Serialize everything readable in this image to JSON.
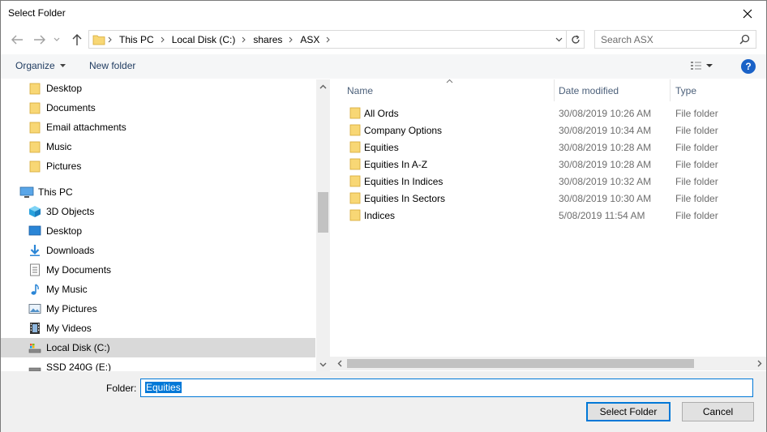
{
  "window": {
    "title": "Select Folder"
  },
  "address": {
    "crumbs": [
      "This PC",
      "Local Disk (C:)",
      "shares",
      "ASX"
    ]
  },
  "search": {
    "placeholder": "Search ASX"
  },
  "commands": {
    "organize": "Organize",
    "new_folder": "New folder"
  },
  "navigation": {
    "quick_access": [
      "Desktop",
      "Documents",
      "Email attachments",
      "Music",
      "Pictures"
    ],
    "this_pc_label": "This PC",
    "this_pc_items": [
      {
        "label": "3D Objects",
        "icon": "3d-objects-icon"
      },
      {
        "label": "Desktop",
        "icon": "desktop-icon"
      },
      {
        "label": "Downloads",
        "icon": "downloads-icon"
      },
      {
        "label": "My Documents",
        "icon": "documents-icon"
      },
      {
        "label": "My Music",
        "icon": "music-icon"
      },
      {
        "label": "My Pictures",
        "icon": "pictures-icon"
      },
      {
        "label": "My Videos",
        "icon": "videos-icon"
      },
      {
        "label": "Local Disk (C:)",
        "icon": "drive-icon",
        "selected": true
      },
      {
        "label": "SSD 240G (E:)",
        "icon": "drive-icon"
      }
    ]
  },
  "columns": {
    "name": "Name",
    "date": "Date modified",
    "type": "Type"
  },
  "files": [
    {
      "name": "All Ords",
      "date": "30/08/2019 10:26 AM",
      "type": "File folder"
    },
    {
      "name": "Company Options",
      "date": "30/08/2019 10:34 AM",
      "type": "File folder"
    },
    {
      "name": "Equities",
      "date": "30/08/2019 10:28 AM",
      "type": "File folder"
    },
    {
      "name": "Equities In A-Z",
      "date": "30/08/2019 10:28 AM",
      "type": "File folder"
    },
    {
      "name": "Equities In Indices",
      "date": "30/08/2019 10:32 AM",
      "type": "File folder"
    },
    {
      "name": "Equities In Sectors",
      "date": "30/08/2019 10:30 AM",
      "type": "File folder"
    },
    {
      "name": "Indices",
      "date": "5/08/2019 11:54 AM",
      "type": "File folder"
    }
  ],
  "footer": {
    "folder_label": "Folder:",
    "folder_value": "Equities",
    "select_button": "Select Folder",
    "cancel_button": "Cancel"
  },
  "colors": {
    "accent": "#0078d7",
    "folder": "#f8d775",
    "help": "#1a62c7"
  }
}
